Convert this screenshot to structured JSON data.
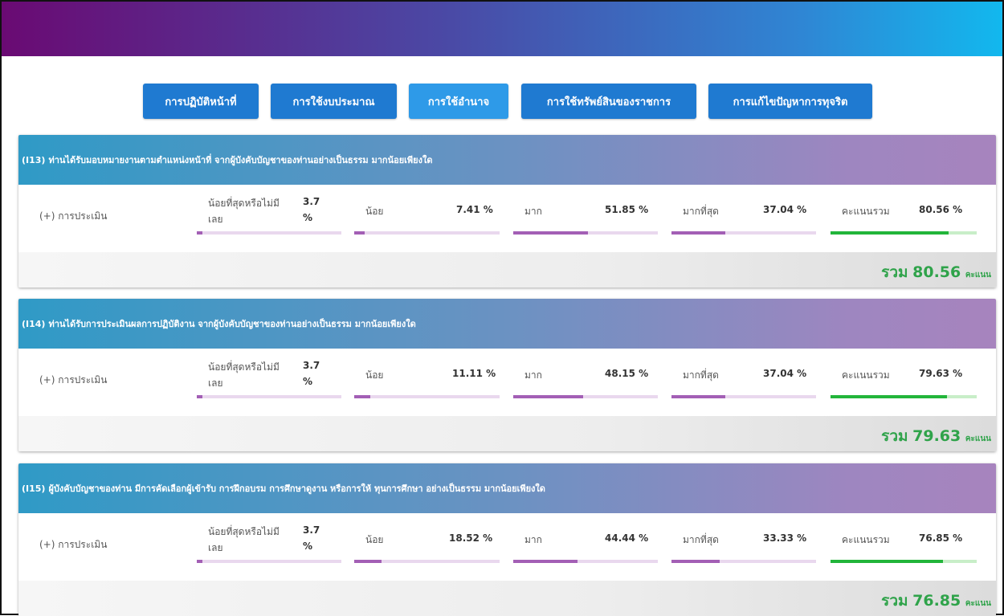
{
  "tabs": [
    {
      "label": "การปฏิบัติหน้าที่"
    },
    {
      "label": "การใช้งบประมาณ"
    },
    {
      "label": "การใช้อำนาจ"
    },
    {
      "label": "การใช้ทรัพย์สินของราชการ"
    },
    {
      "label": "การแก้ไขปัญหาการทุจริต"
    }
  ],
  "active_tab": "การใช้อำนาจ",
  "colors": {
    "accent_button": "#1f7ad1",
    "score_green": "#2fa34a",
    "bar_purple": "#a35fb5",
    "bar_green": "#22b53a"
  },
  "questions": [
    {
      "id": "(I13)",
      "text": "ท่านได้รับมอบหมายงานตามตำแหน่งหน้าที่ จากผู้บังคับบัญชาของท่านอย่างเป็นธรรม มากน้อยเพียงใด",
      "assess_label": "(+) การประเมิน",
      "least_line1": "น้อยที่สุดหรือไม่มี",
      "least_line2": "เลย",
      "least_val1": "3.7",
      "least_val2": "%",
      "little_label": "น้อย",
      "little_val": "7.41 %",
      "much_label": "มาก",
      "much_val": "51.85 %",
      "most_label": "มากที่สุด",
      "most_val": "37.04 %",
      "total_label": "คะแนนรวม",
      "total_val": "80.56 %",
      "sum_prefix": "รวม",
      "sum_value": "80.56",
      "sum_unit": "คะแนน",
      "levels": {
        "least": 3.7,
        "little": 7.41,
        "much": 51.85,
        "most": 37.04,
        "total": 80.56
      }
    },
    {
      "id": "(I14)",
      "text": "ท่านได้รับการประเมินผลการปฏิบัติงาน จากผู้บังคับบัญชาของท่านอย่างเป็นธรรม มากน้อยเพียงใด",
      "assess_label": "(+) การประเมิน",
      "least_line1": "น้อยที่สุดหรือไม่มี",
      "least_line2": "เลย",
      "least_val1": "3.7",
      "least_val2": "%",
      "little_label": "น้อย",
      "little_val": "11.11 %",
      "much_label": "มาก",
      "much_val": "48.15 %",
      "most_label": "มากที่สุด",
      "most_val": "37.04 %",
      "total_label": "คะแนนรวม",
      "total_val": "79.63 %",
      "sum_prefix": "รวม",
      "sum_value": "79.63",
      "sum_unit": "คะแนน",
      "levels": {
        "least": 3.7,
        "little": 11.11,
        "much": 48.15,
        "most": 37.04,
        "total": 79.63
      }
    },
    {
      "id": "(I15)",
      "text": "ผู้บังคับบัญชาของท่าน มีการคัดเลือกผู้เข้ารับ การฝึกอบรม การศึกษาดูงาน หรือการให้ ทุนการศึกษา อย่างเป็นธรรม มากน้อยเพียงใด",
      "assess_label": "(+) การประเมิน",
      "least_line1": "น้อยที่สุดหรือไม่มี",
      "least_line2": "เลย",
      "least_val1": "3.7",
      "least_val2": "%",
      "little_label": "น้อย",
      "little_val": "18.52 %",
      "much_label": "มาก",
      "much_val": "44.44 %",
      "most_label": "มากที่สุด",
      "most_val": "33.33 %",
      "total_label": "คะแนนรวม",
      "total_val": "76.85 %",
      "sum_prefix": "รวม",
      "sum_value": "76.85",
      "sum_unit": "คะแนน",
      "levels": {
        "least": 3.7,
        "little": 18.52,
        "much": 44.44,
        "most": 33.33,
        "total": 76.85
      }
    }
  ]
}
